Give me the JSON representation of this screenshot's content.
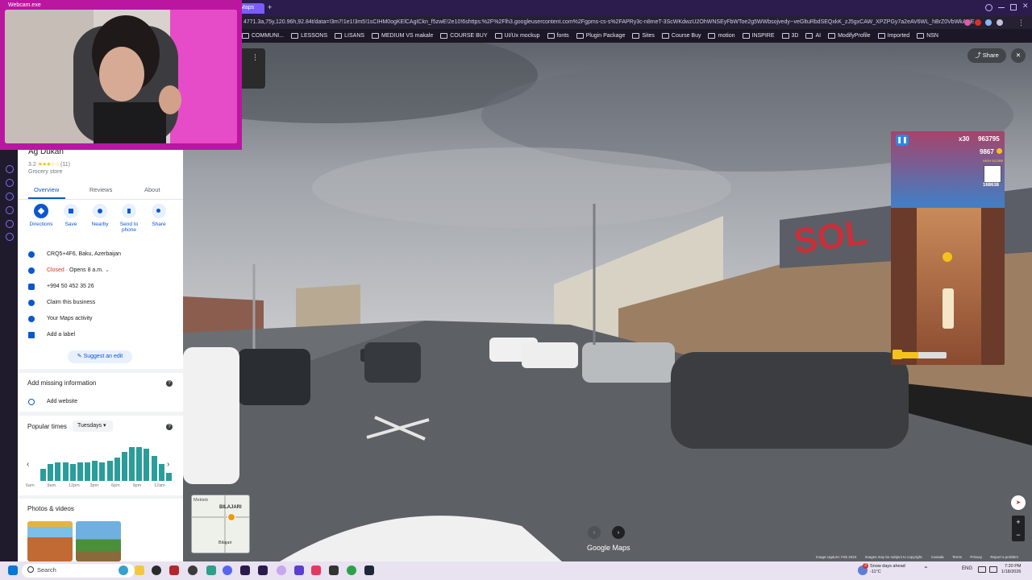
{
  "browser": {
    "webcam_tab_title": "Webcam.exe",
    "maps_tab_label": "Maps",
    "new_tab_glyph": "+",
    "url": "4771.3a,75y,120.96h,92.84t/data=!3m7!1e1!3m5!1sCIHM0ogKElCAgICkn_f5zwE!2e10!6shttps:%2F%2Flh3.googleusercontent.com%2Fgpms-cs-s%2FAPRy3c-n8meT-3ScWKdwzU2OhWNSEyFbWToe2g5WWbsojvedy--veGltuRbdSEQxkK_zJ5gxCAW_XPZPGy7a2eAV6WL_hBrZ0VbWkA8jE",
    "bookmarks": [
      "COMMUNI...",
      "LESSONS",
      "LISANS",
      "MEDIUM VS makale",
      "COURSE BUY",
      "UI/Ux mockup",
      "fonts",
      "Plugin Package",
      "Sites",
      "Course Buy",
      "motion",
      "INSPIRE",
      "3D",
      "AI",
      "ModifyProfile",
      "Imported",
      "NSN"
    ]
  },
  "place": {
    "name": "Ag Dukan",
    "rating": "3.2",
    "stars": "★★★☆☆",
    "review_count": "(11)",
    "category": "Grocery store",
    "tabs": [
      "Overview",
      "Reviews",
      "About"
    ],
    "actions": [
      {
        "label": "Directions",
        "icon": "directions-icon"
      },
      {
        "label": "Save",
        "icon": "bookmark-icon"
      },
      {
        "label": "Nearby",
        "icon": "nearby-icon"
      },
      {
        "label": "Send to phone",
        "icon": "phone-icon"
      },
      {
        "label": "Share",
        "icon": "share-icon"
      }
    ],
    "info_rows": [
      {
        "icon": "location-pin-icon",
        "text": "CRQ5+4F6, Baku, Azerbaijan"
      },
      {
        "icon": "clock-icon",
        "status": "Closed",
        "text": " · Opens 8 a.m."
      },
      {
        "icon": "phone-icon",
        "text": "+994 50 452 35 26"
      },
      {
        "icon": "verified-shield-icon",
        "text": "Claim this business"
      },
      {
        "icon": "activity-icon",
        "text": "Your Maps activity"
      },
      {
        "icon": "label-icon",
        "text": "Add a label"
      }
    ],
    "suggest_edit": "Suggest an edit",
    "missing_info_title": "Add missing information",
    "add_website": "Add website",
    "popular_times_title": "Popular times",
    "popular_day": "Tuesdays",
    "popular_times_values": [
      0.35,
      0.5,
      0.55,
      0.55,
      0.5,
      0.55,
      0.55,
      0.6,
      0.55,
      0.6,
      0.7,
      0.85,
      1.0,
      1.0,
      0.95,
      0.75,
      0.5,
      0.25
    ],
    "popular_times_ticks": [
      "6am",
      "9am",
      "12pm",
      "3pm",
      "6pm",
      "9pm",
      "12am"
    ],
    "photos_title": "Photos & videos"
  },
  "streetview": {
    "share_label": "Share",
    "close_glyph": "✕",
    "brand": "Google Maps",
    "minimap_labels": [
      "Mekteb",
      "BILAJARI",
      "Bilajari"
    ],
    "footer": [
      "Image capture: Feb 2023",
      "Images may be subject to copyright.",
      "Canada",
      "Terms",
      "Privacy",
      "Report a problem"
    ]
  },
  "game": {
    "multiplier": "x30",
    "score": "963795",
    "coins": "9867",
    "high_score_label": "HIGH SCORE",
    "high_score": "168638",
    "progress": 0.45
  },
  "taskbar": {
    "search_placeholder": "Search",
    "weather_title": "Snow days ahead",
    "temperature": "-11°C",
    "language": "ENG",
    "time": "7:20 PM",
    "date": "1/18/2026",
    "notification_count": "3"
  },
  "colors": {
    "maps_blue": "#0b57d0",
    "closed_red": "#d93025",
    "popular_bar": "#2a9d9a",
    "webcam_frame": "#bb16a0"
  }
}
